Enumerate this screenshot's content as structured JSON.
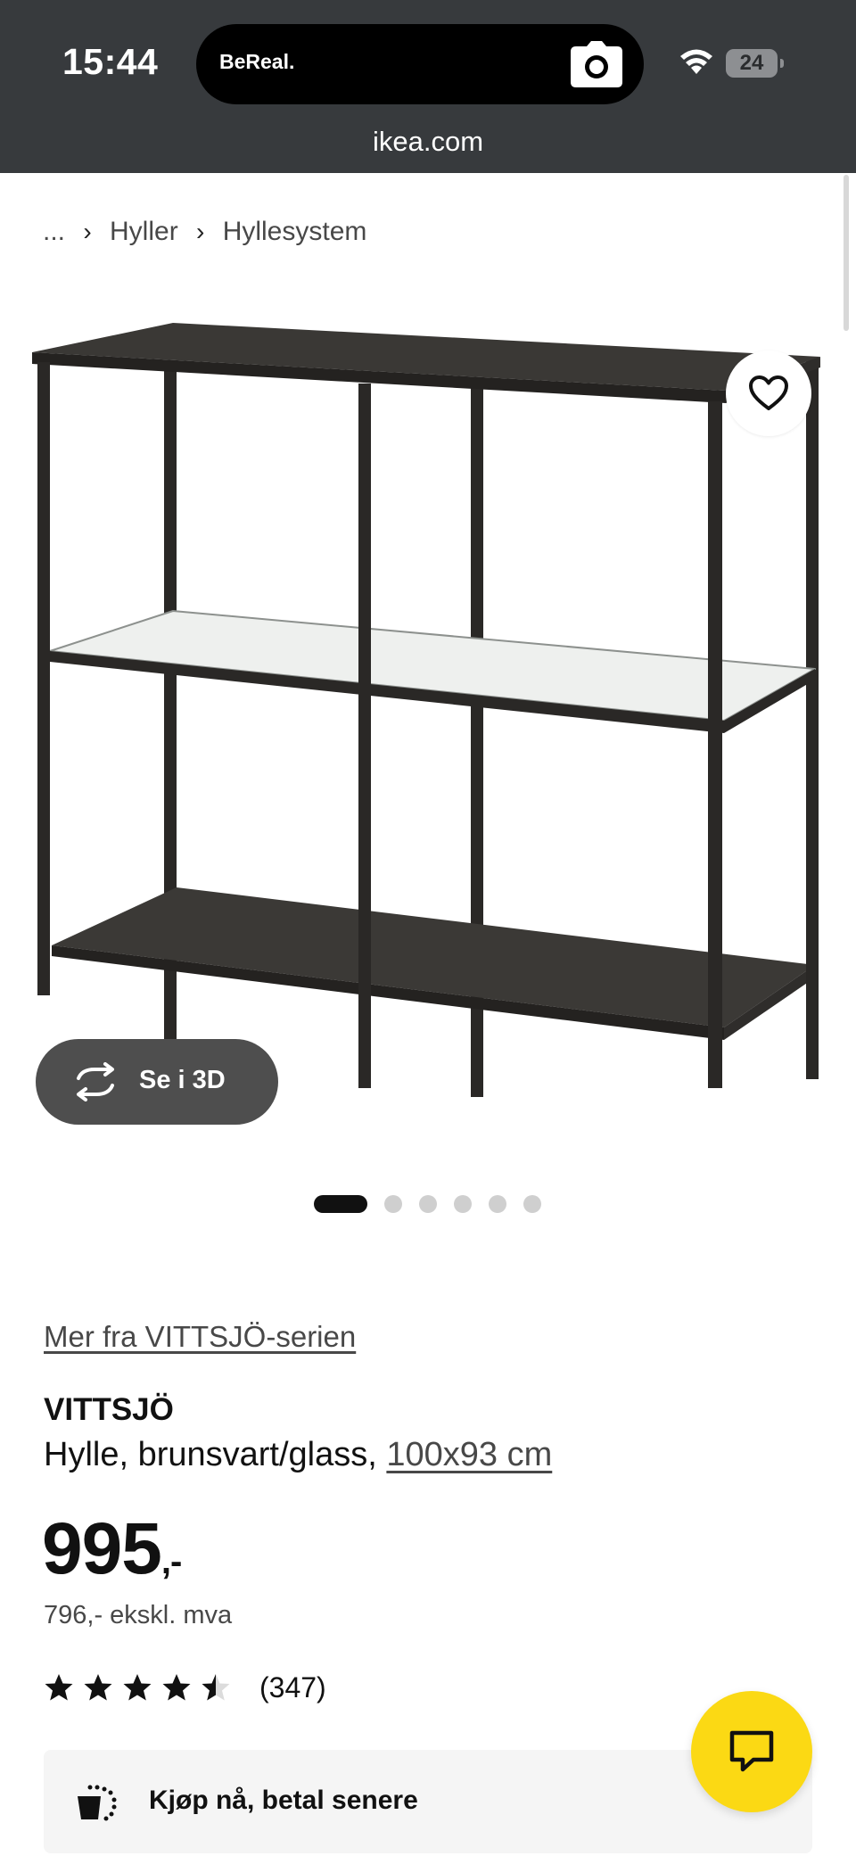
{
  "status_bar": {
    "time": "15:44",
    "island_label": "BeReal.",
    "battery": "24",
    "url": "ikea.com"
  },
  "breadcrumb": {
    "items": [
      "...",
      "Hyller",
      "Hyllesystem"
    ]
  },
  "gallery": {
    "view_3d_label": "Se i 3D",
    "image_count": 6,
    "active_index": 0
  },
  "product": {
    "series_link": "Mer fra VITTSJÖ-serien",
    "name": "VITTSJÖ",
    "description": "Hylle, brunsvart/glass, ",
    "size": "100x93 cm",
    "price": "995",
    "price_suffix": ",-",
    "price_excl_vat": "796,- ekskl. mva",
    "rating": 4.5,
    "review_count": "(347)",
    "bnpl_label": "Kjøp nå, betal senere"
  },
  "icons": {
    "favorite": "heart-icon",
    "rotate_3d": "rotate-icon",
    "chat": "chat-icon",
    "bnpl": "shopping-bag-icon"
  },
  "colors": {
    "status_bar": "#373a3d",
    "chat_button": "#fbd914",
    "view_3d_button": "#4e4e4e",
    "text": "#111111"
  }
}
